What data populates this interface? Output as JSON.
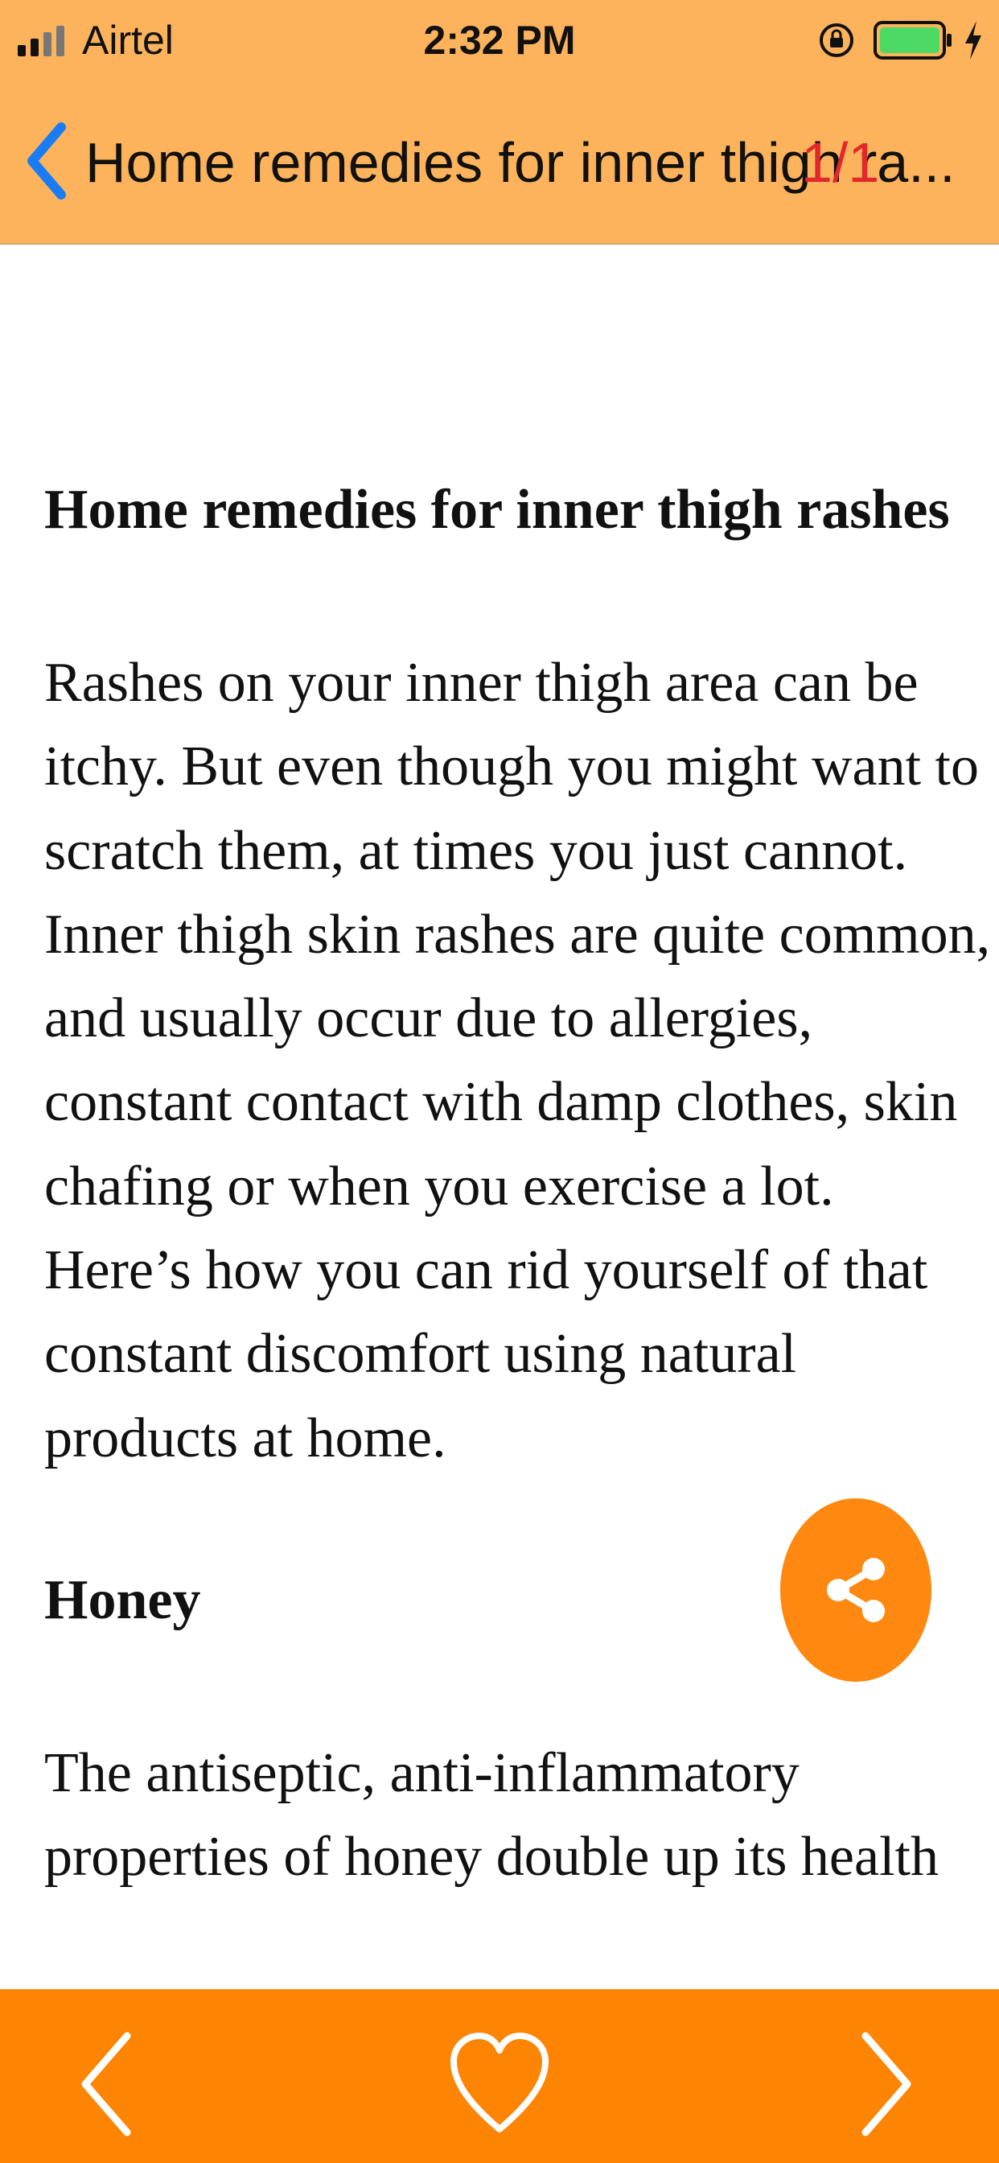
{
  "status_bar": {
    "carrier": "Airtel",
    "time": "2:32 PM",
    "battery_color": "#4CD964"
  },
  "nav": {
    "title": "Home remedies for inner thigh ra...",
    "counter": "1/1",
    "back_icon": "chevron-left-icon",
    "accent_color": "#1A7CF5"
  },
  "article": {
    "heading": "Home remedies for inner thigh rashes",
    "intro": "Rashes on your inner thigh area can be itchy. But even though you might want to scratch them, at times you just cannot. Inner thigh skin rashes are quite common, and usually occur due to allergies, constant contact with damp clothes, skin chafing or when you exercise a lot. Here’s how you can rid yourself of that constant discomfort using natural products at home.",
    "section_heading": "Honey",
    "section_text": "The antiseptic, anti-inflammatory properties of honey double up its health"
  },
  "share_button": {
    "icon": "share-icon",
    "color": "#FE8810"
  },
  "bottom_bar": {
    "color": "#FE8403",
    "prev_icon": "chevron-left-icon",
    "favorite_icon": "heart-outline-icon",
    "next_icon": "chevron-right-icon"
  }
}
